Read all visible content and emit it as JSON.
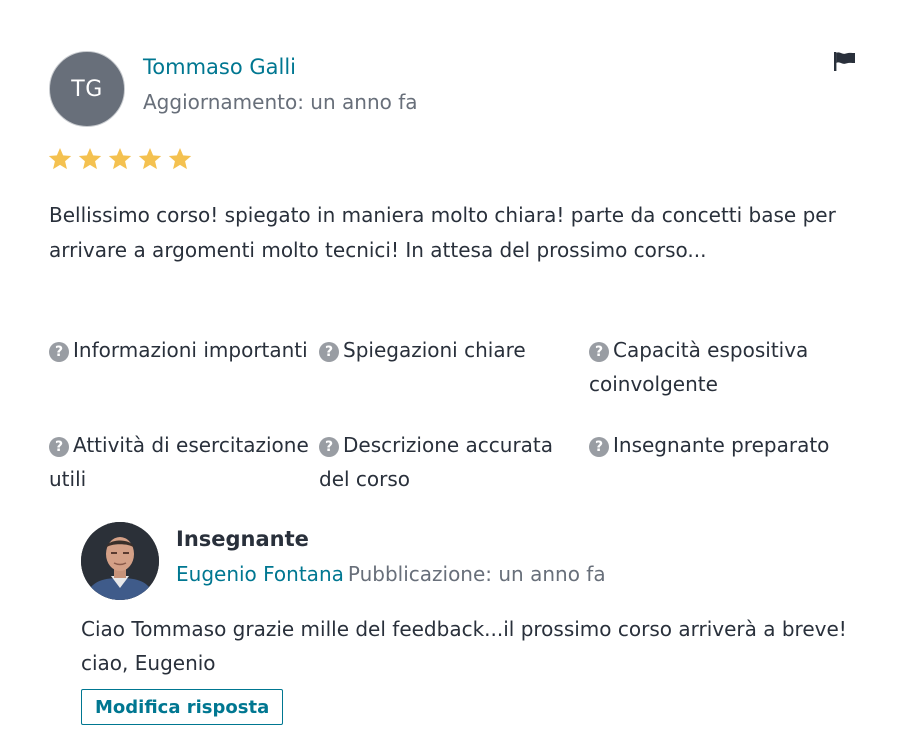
{
  "review": {
    "avatar_initials": "TG",
    "author_name": "Tommaso Galli",
    "updated": "Aggiornamento: un anno fa",
    "rating": 5,
    "rating_max": 5,
    "text": "Bellissimo corso! spiegato in maniera molto chiara! parte da concetti base per arrivare a argomenti molto tecnici! In attesa del prossimo corso...",
    "flag_icon": "flag-icon",
    "attributes": [
      {
        "icon": "question-circle-icon",
        "label": "Informazioni importanti"
      },
      {
        "icon": "question-circle-icon",
        "label": "Spiegazioni chiare"
      },
      {
        "icon": "question-circle-icon",
        "label": "Capacità espositiva coinvolgente"
      },
      {
        "icon": "question-circle-icon",
        "label": "Attività di esercitazione utili"
      },
      {
        "icon": "question-circle-icon",
        "label": "Descrizione accurata del corso"
      },
      {
        "icon": "question-circle-icon",
        "label": "Insegnante preparato"
      }
    ]
  },
  "response": {
    "role": "Insegnante",
    "instructor_name": "Eugenio Fontana",
    "published": "Pubblicazione: un anno fa",
    "text": "Ciao Tommaso grazie mille del feedback...il prossimo corso arriverà a breve! ciao, Eugenio",
    "edit_button": "Modifica risposta"
  },
  "colors": {
    "link": "#007791",
    "star": "#f4c150",
    "muted": "#686f7a",
    "text": "#29303b",
    "avatar_bg": "#686f7a"
  }
}
